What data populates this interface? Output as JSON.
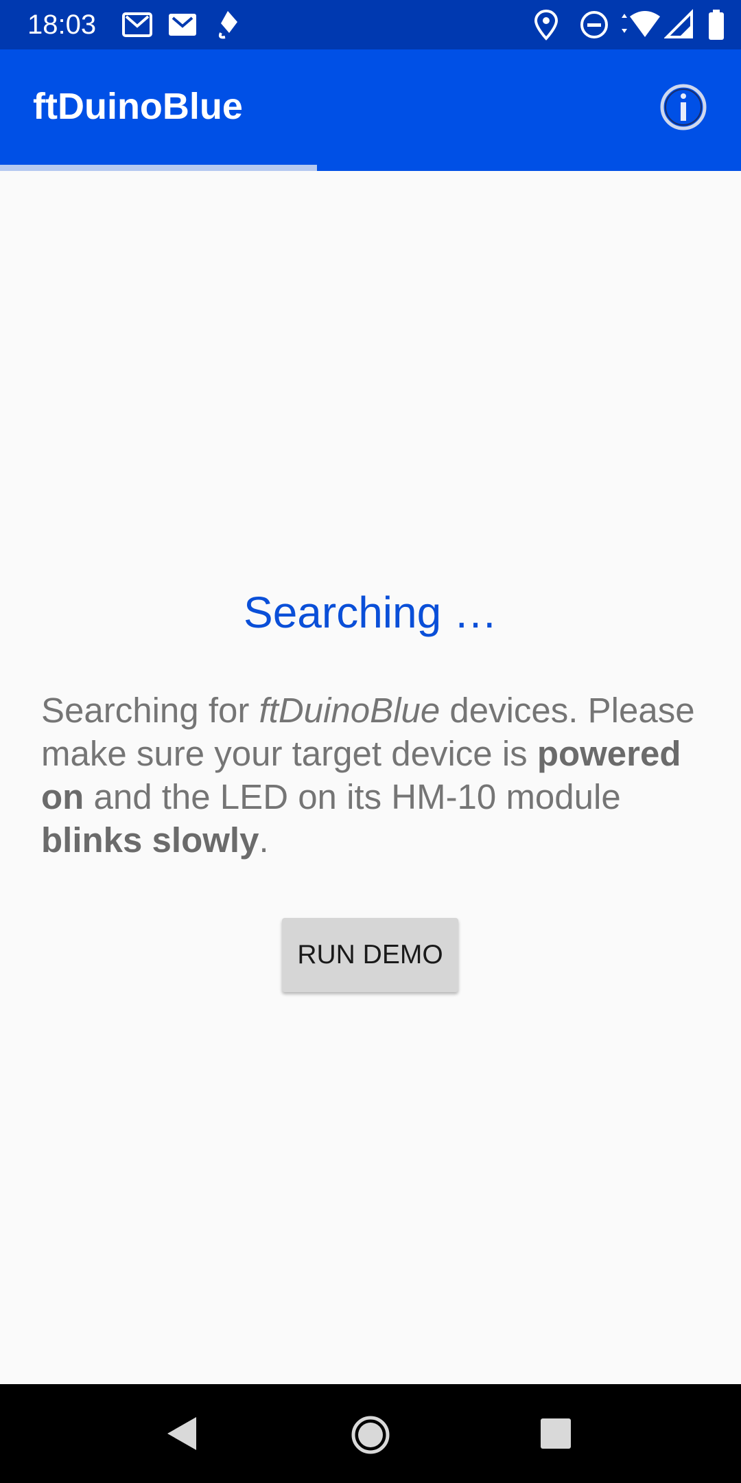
{
  "status_bar": {
    "time": "18:03",
    "left_icons": [
      "gmail-icon",
      "gmail-icon",
      "pen-icon"
    ],
    "right_icons": [
      "location-icon",
      "do-not-disturb-icon",
      "wifi-icon",
      "signal-icon",
      "battery-icon"
    ]
  },
  "app_bar": {
    "title": "ftDuinoBlue",
    "action_icon": "info-icon",
    "color": "#0050e6"
  },
  "progress": {
    "indeterminate": true
  },
  "main": {
    "heading": "Searching …",
    "desc": {
      "p1": "Searching for ",
      "p2": "ftDuinoBlue",
      "p3": " devices. Please make sure your target device is ",
      "p4": "powered on",
      "p5": " and the LED on its HM-10 module ",
      "p6": "blinks slowly",
      "p7": "."
    },
    "button_label": "RUN DEMO"
  },
  "nav_bar": {
    "icons": [
      "back-icon",
      "home-icon",
      "recents-icon"
    ]
  }
}
